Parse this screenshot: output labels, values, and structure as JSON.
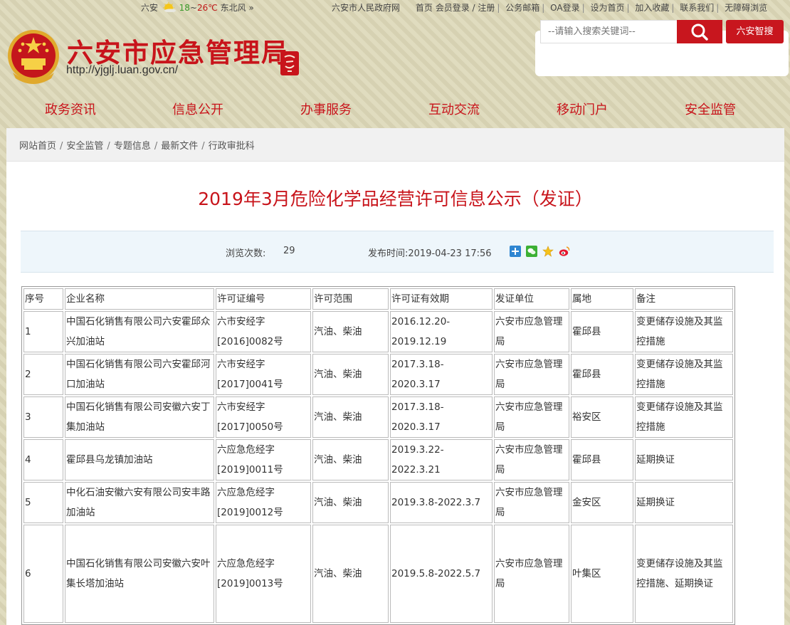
{
  "topbar": {
    "city": "六安",
    "temp_low": "18",
    "temp_sep": "~",
    "temp_high": "26℃",
    "wind": "东北风",
    "more": "»",
    "links": [
      "六安市人民政府网",
      "首页",
      "会员登录 / 注册",
      "公务邮箱",
      "OA登录",
      "设为首页",
      "加入收藏",
      "联系我们",
      "无障碍浏览"
    ],
    "separator": "|"
  },
  "header": {
    "title": "六安市应急管理局",
    "url": "http://yjglj.luan.gov.cn/",
    "seal_text": "六安印象"
  },
  "search": {
    "placeholder": "--请输入搜索关键词--",
    "smart_label": "六安智搜"
  },
  "nav": {
    "items": [
      "政务资讯",
      "信息公开",
      "办事服务",
      "互动交流",
      "移动门户",
      "安全监管"
    ]
  },
  "breadcrumb": {
    "items": [
      "网站首页",
      "安全监管",
      "专题信息",
      "最新文件",
      "行政审批科"
    ],
    "separator": "/"
  },
  "article": {
    "title": "2019年3月危险化学品经营许可信息公示（发证）",
    "views_label": "浏览次数:",
    "views": "29",
    "date_label": "发布时间:",
    "date": "2019-04-23 17:56",
    "share_icons": [
      "plus-share-icon",
      "wechat-icon",
      "star-icon",
      "weibo-icon"
    ]
  },
  "table": {
    "headers": [
      "序号",
      "企业名称",
      "许可证编号",
      "许可范围",
      "许可证有效期",
      "发证单位",
      "属地",
      "备注"
    ],
    "rows": [
      [
        "1",
        "中国石化销售有限公司六安霍邱众兴加油站",
        "六市安经字[2016]0082号",
        "汽油、柴油",
        "2016.12.20-2019.12.19",
        "六安市应急管理局",
        "霍邱县",
        "变更储存设施及其监控措施"
      ],
      [
        "2",
        "中国石化销售有限公司六安霍邱河口加油站",
        "六市安经字[2017]0041号",
        "汽油、柴油",
        "2017.3.18-2020.3.17",
        "六安市应急管理局",
        "霍邱县",
        "变更储存设施及其监控措施"
      ],
      [
        "3",
        "中国石化销售有限公司安徽六安丁集加油站",
        "六市安经字[2017]0050号",
        "汽油、柴油",
        "2017.3.18-2020.3.17",
        "六安市应急管理局",
        "裕安区",
        "变更储存设施及其监控措施"
      ],
      [
        "4",
        "霍邱县乌龙镇加油站",
        "六应急危经字[2019]0011号",
        "汽油、柴油",
        "2019.3.22-2022.3.21",
        "六安市应急管理局",
        "霍邱县",
        "延期换证"
      ],
      [
        "5",
        "中化石油安徽六安有限公司安丰路加油站",
        "六应急危经字[2019]0012号",
        "汽油、柴油",
        "2019.3.8-2022.3.7",
        "六安市应急管理局",
        "金安区",
        "延期换证"
      ],
      [
        "6",
        "中国石化销售有限公司安徽六安叶集长塔加油站",
        "六应急危经字[2019]0013号",
        "汽油、柴油",
        "2019.5.8-2022.5.7",
        "六安市应急管理局",
        "叶集区",
        "变更储存设施及其监控措施、延期换证"
      ]
    ]
  },
  "colors": {
    "brand_red": "#c8141b",
    "page_bg": "#ddd8b8",
    "meta_bg": "#eef6fb"
  }
}
